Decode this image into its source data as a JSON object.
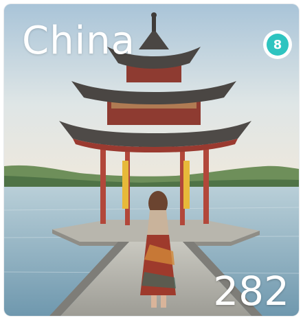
{
  "card": {
    "title": "China",
    "badge_count": "8",
    "total_count": "282",
    "photo_icon": "pagoda-photo",
    "colors": {
      "badge": "#2ec4c0",
      "text": "#ffffff"
    }
  }
}
